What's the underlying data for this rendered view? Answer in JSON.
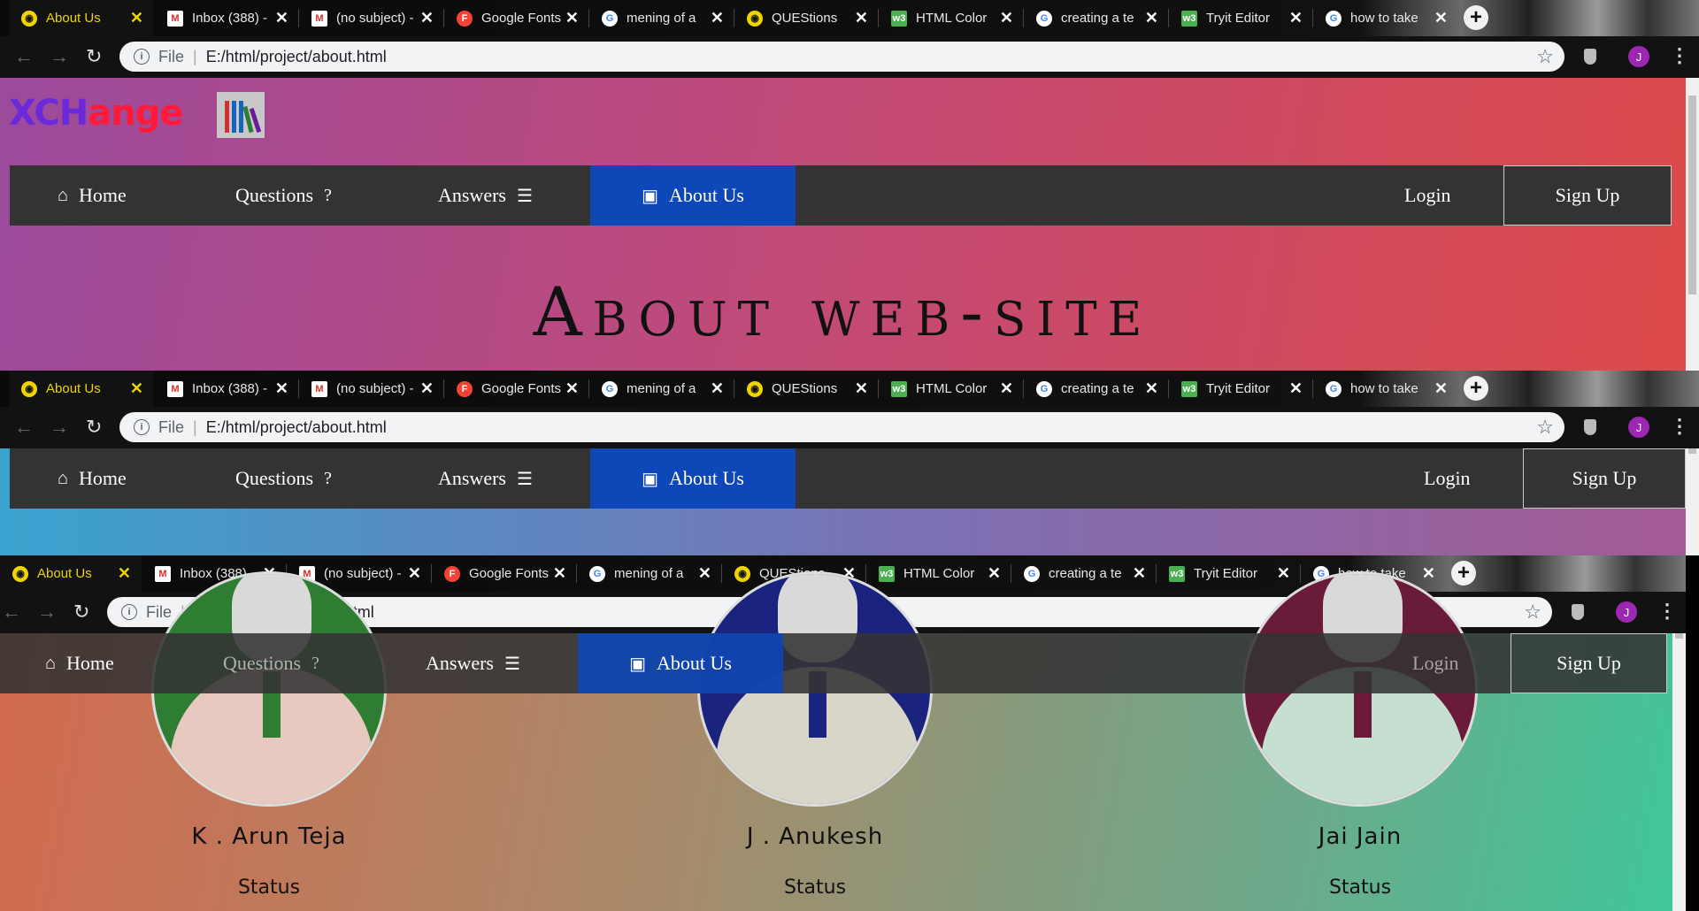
{
  "browser": {
    "tabs": [
      {
        "title": "About Us",
        "icon": "chrome-icon",
        "active": true
      },
      {
        "title": "Inbox (388) -",
        "icon": "gmail-icon"
      },
      {
        "title": "(no subject) -",
        "icon": "gmail-icon"
      },
      {
        "title": "Google Fonts",
        "icon": "google-fonts-icon"
      },
      {
        "title": "mening of a",
        "icon": "google-icon"
      },
      {
        "title": "QUEStions",
        "icon": "chrome-icon"
      },
      {
        "title": "HTML Color",
        "icon": "w3schools-icon"
      },
      {
        "title": "creating a te",
        "icon": "google-icon"
      },
      {
        "title": "Tryit Editor",
        "icon": "w3schools-icon"
      },
      {
        "title": "how to take",
        "icon": "google-icon"
      }
    ],
    "url_scheme": "File",
    "url": "E:/html/project/about.html",
    "avatar_letter": "J"
  },
  "site": {
    "logo_part1": "XCH",
    "logo_part2": "ange",
    "nav": {
      "home": "Home",
      "questions": "Questions",
      "answers": "Answers",
      "about": "About Us",
      "login": "Login",
      "signup": "Sign Up"
    },
    "hero_title": "About web-site"
  },
  "team": [
    {
      "name": "K . Arun Teja",
      "status": "Status",
      "color": "#2e7d32"
    },
    {
      "name": "J . Anukesh",
      "status": "Status",
      "color": "#1a237e"
    },
    {
      "name": "Jai Jain",
      "status": "Status",
      "color": "#6a1b3a"
    }
  ],
  "colors": {
    "accent": "#0d47b8",
    "navbar": "#333333",
    "active_tab_text": "#f0d400"
  }
}
